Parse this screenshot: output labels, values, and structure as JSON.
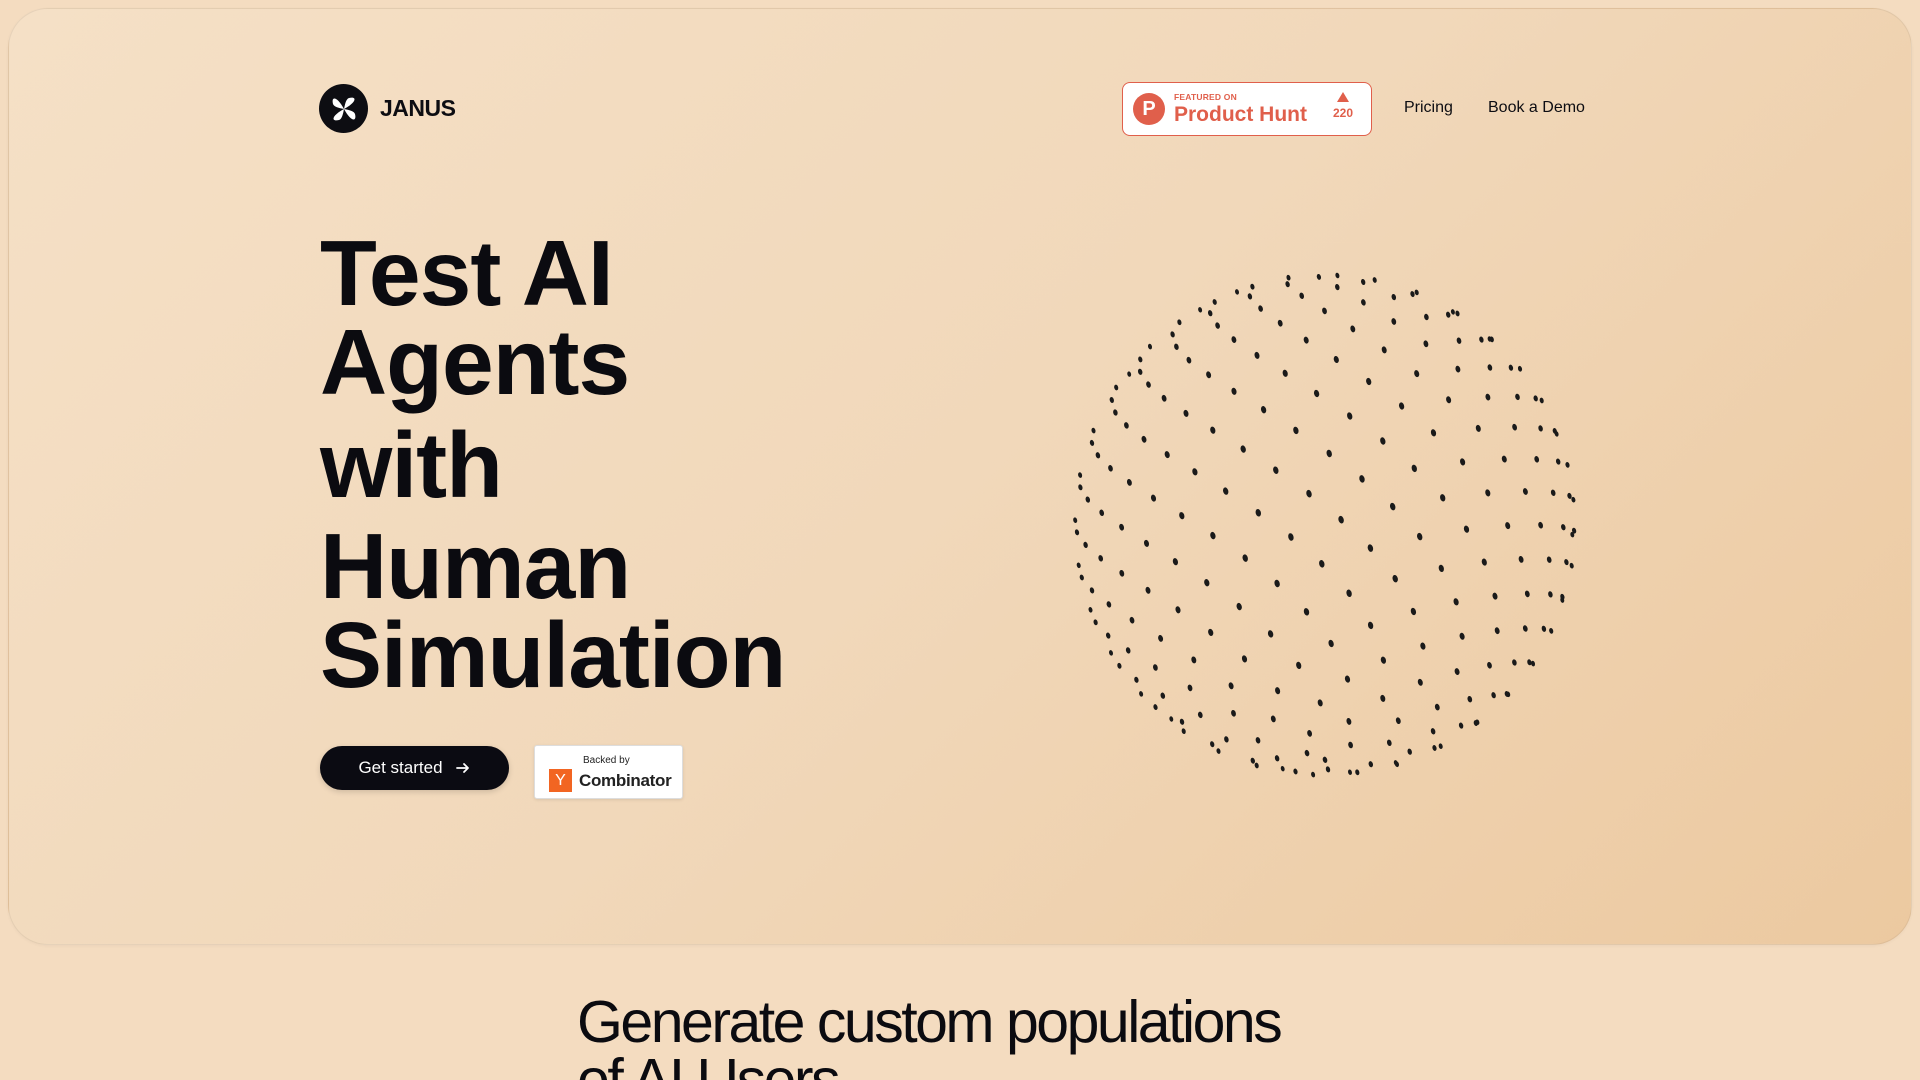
{
  "brand": {
    "name": "JANUS",
    "logo_icon": "x-star-icon"
  },
  "nav": {
    "product_hunt": {
      "featured": "FEATURED ON",
      "name": "Product Hunt",
      "votes": "220",
      "color": "#e05f4b"
    },
    "links": [
      "Pricing",
      "Book a Demo"
    ]
  },
  "hero": {
    "headline_lines": [
      "Test AI",
      "Agents",
      "with",
      "Human",
      "Simulation"
    ],
    "cta_label": "Get started",
    "cta_icon": "arrow-right-icon",
    "yc": {
      "backed": "Backed by",
      "y": "Y",
      "name": "Combinator",
      "color": "#f26522"
    },
    "visual": "dot-sphere"
  },
  "section": {
    "title_line1": "Generate custom populations",
    "title_line2": "of AI Users"
  }
}
